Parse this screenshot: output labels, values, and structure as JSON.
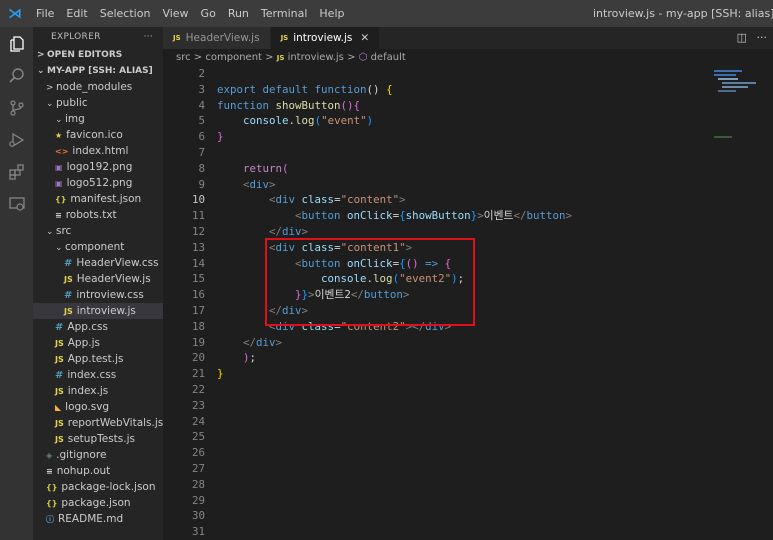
{
  "titlebar": {
    "menu": [
      "File",
      "Edit",
      "Selection",
      "View",
      "Go",
      "Run",
      "Terminal",
      "Help"
    ],
    "window_title": "introview.js - my-app [SSH: alias] - Visual Studio"
  },
  "activity_bar": [
    "files-icon",
    "search-icon",
    "source-control-icon",
    "run-debug-icon",
    "extensions-icon",
    "remote-explorer-icon"
  ],
  "sidebar": {
    "header": "EXPLORER",
    "header_more": "···",
    "open_editors": "OPEN EDITORS",
    "project": "MY-APP [SSH: ALIAS]",
    "items": [
      {
        "label": "node_modules",
        "chev": ">",
        "indent": 1,
        "icon": ""
      },
      {
        "label": "public",
        "chev": "⌄",
        "indent": 1,
        "icon": ""
      },
      {
        "label": "img",
        "chev": "⌄",
        "indent": 2,
        "icon": ""
      },
      {
        "label": "favicon.ico",
        "chev": "",
        "indent": 2,
        "icon": "★",
        "icls": "ic-star"
      },
      {
        "label": "index.html",
        "chev": "",
        "indent": 2,
        "icon": "<>",
        "icls": "ic-html"
      },
      {
        "label": "logo192.png",
        "chev": "",
        "indent": 2,
        "icon": "▣",
        "icls": "ic-img"
      },
      {
        "label": "logo512.png",
        "chev": "",
        "indent": 2,
        "icon": "▣",
        "icls": "ic-img"
      },
      {
        "label": "manifest.json",
        "chev": "",
        "indent": 2,
        "icon": "{}",
        "icls": "ic-json"
      },
      {
        "label": "robots.txt",
        "chev": "",
        "indent": 2,
        "icon": "≡",
        "icls": "ic-txt"
      },
      {
        "label": "src",
        "chev": "⌄",
        "indent": 1,
        "icon": ""
      },
      {
        "label": "component",
        "chev": "⌄",
        "indent": 2,
        "icon": ""
      },
      {
        "label": "HeaderView.css",
        "chev": "",
        "indent": 3,
        "icon": "#",
        "icls": "ic-css"
      },
      {
        "label": "HeaderView.js",
        "chev": "",
        "indent": 3,
        "icon": "JS",
        "icls": "ic-js"
      },
      {
        "label": "introview.css",
        "chev": "",
        "indent": 3,
        "icon": "#",
        "icls": "ic-css"
      },
      {
        "label": "introview.js",
        "chev": "",
        "indent": 3,
        "icon": "JS",
        "icls": "ic-js",
        "selected": true
      },
      {
        "label": "App.css",
        "chev": "",
        "indent": 2,
        "icon": "#",
        "icls": "ic-css"
      },
      {
        "label": "App.js",
        "chev": "",
        "indent": 2,
        "icon": "JS",
        "icls": "ic-js"
      },
      {
        "label": "App.test.js",
        "chev": "",
        "indent": 2,
        "icon": "JS",
        "icls": "ic-js"
      },
      {
        "label": "index.css",
        "chev": "",
        "indent": 2,
        "icon": "#",
        "icls": "ic-css"
      },
      {
        "label": "index.js",
        "chev": "",
        "indent": 2,
        "icon": "JS",
        "icls": "ic-js"
      },
      {
        "label": "logo.svg",
        "chev": "",
        "indent": 2,
        "icon": "◣",
        "icls": "ic-svg"
      },
      {
        "label": "reportWebVitals.js",
        "chev": "",
        "indent": 2,
        "icon": "JS",
        "icls": "ic-js"
      },
      {
        "label": "setupTests.js",
        "chev": "",
        "indent": 2,
        "icon": "JS",
        "icls": "ic-js"
      },
      {
        "label": ".gitignore",
        "chev": "",
        "indent": 1,
        "icon": "◈",
        "icls": "ic-git"
      },
      {
        "label": "nohup.out",
        "chev": "",
        "indent": 1,
        "icon": "≡",
        "icls": "ic-txt"
      },
      {
        "label": "package-lock.json",
        "chev": "",
        "indent": 1,
        "icon": "{}",
        "icls": "ic-json"
      },
      {
        "label": "package.json",
        "chev": "",
        "indent": 1,
        "icon": "{}",
        "icls": "ic-json"
      },
      {
        "label": "README.md",
        "chev": "",
        "indent": 1,
        "icon": "ⓘ",
        "icls": "ic-info"
      }
    ]
  },
  "tabs": [
    {
      "label": "HeaderView.js",
      "active": false
    },
    {
      "label": "introview.js",
      "active": true,
      "close": "✕"
    }
  ],
  "tab_actions": {
    "split": "◫",
    "more": "···"
  },
  "breadcrumb": {
    "parts": [
      "src",
      "component",
      "introview.js",
      "default"
    ],
    "sep": ">"
  },
  "editor": {
    "current_line": 10,
    "lines": [
      {
        "n": 2,
        "tokens": []
      },
      {
        "n": 3,
        "tokens": [
          [
            "kw",
            "export "
          ],
          [
            "kw",
            "default "
          ],
          [
            "kw",
            "function"
          ],
          [
            "txt",
            "() "
          ],
          [
            "brace2",
            "{"
          ]
        ]
      },
      {
        "n": 4,
        "tokens": [
          [
            "kw",
            "function "
          ],
          [
            "fn",
            "showButton"
          ],
          [
            "brace",
            "()"
          ],
          [
            "brace",
            "{"
          ]
        ]
      },
      {
        "n": 5,
        "tokens": [
          [
            "txt",
            "    "
          ],
          [
            "var",
            "console"
          ],
          [
            "txt",
            "."
          ],
          [
            "fn",
            "log"
          ],
          [
            "brace3",
            "("
          ],
          [
            "str",
            "\"event\""
          ],
          [
            "brace3",
            ")"
          ]
        ]
      },
      {
        "n": 6,
        "tokens": [
          [
            "brace",
            "}"
          ]
        ]
      },
      {
        "n": 7,
        "tokens": []
      },
      {
        "n": 8,
        "tokens": [
          [
            "txt",
            "    "
          ],
          [
            "kw2",
            "return"
          ],
          [
            "brace",
            "("
          ]
        ]
      },
      {
        "n": 9,
        "tokens": [
          [
            "txt",
            "    "
          ],
          [
            "punc",
            "<"
          ],
          [
            "tag",
            "div"
          ],
          [
            "punc",
            ">"
          ]
        ]
      },
      {
        "n": 10,
        "tokens": [
          [
            "txt",
            "        "
          ],
          [
            "punc",
            "<"
          ],
          [
            "tag",
            "div "
          ],
          [
            "attr",
            "class"
          ],
          [
            "txt",
            "="
          ],
          [
            "str",
            "\"content\""
          ],
          [
            "punc",
            ">"
          ]
        ]
      },
      {
        "n": 11,
        "tokens": [
          [
            "txt",
            "            "
          ],
          [
            "punc",
            "<"
          ],
          [
            "tag",
            "button "
          ],
          [
            "attr",
            "onClick"
          ],
          [
            "txt",
            "="
          ],
          [
            "brace3",
            "{"
          ],
          [
            "var",
            "showButton"
          ],
          [
            "brace3",
            "}"
          ],
          [
            "punc",
            ">"
          ],
          [
            "txt",
            "이벤트"
          ],
          [
            "punc",
            "</"
          ],
          [
            "tag",
            "button"
          ],
          [
            "punc",
            ">"
          ]
        ]
      },
      {
        "n": 12,
        "tokens": [
          [
            "txt",
            "        "
          ],
          [
            "punc",
            "</"
          ],
          [
            "tag",
            "div"
          ],
          [
            "punc",
            ">"
          ]
        ]
      },
      {
        "n": 13,
        "tokens": [
          [
            "txt",
            "        "
          ],
          [
            "punc",
            "<"
          ],
          [
            "tag",
            "div "
          ],
          [
            "attr",
            "class"
          ],
          [
            "txt",
            "="
          ],
          [
            "str",
            "\"content1\""
          ],
          [
            "punc",
            ">"
          ]
        ]
      },
      {
        "n": 14,
        "tokens": [
          [
            "txt",
            "            "
          ],
          [
            "punc",
            "<"
          ],
          [
            "tag",
            "button "
          ],
          [
            "attr",
            "onClick"
          ],
          [
            "txt",
            "="
          ],
          [
            "brace3",
            "{"
          ],
          [
            "brace",
            "() "
          ],
          [
            "kw",
            "=>"
          ],
          [
            "txt",
            " "
          ],
          [
            "brace",
            "{"
          ]
        ]
      },
      {
        "n": 15,
        "tokens": [
          [
            "txt",
            "                "
          ],
          [
            "var",
            "console"
          ],
          [
            "txt",
            "."
          ],
          [
            "fn",
            "log"
          ],
          [
            "brace3",
            "("
          ],
          [
            "str",
            "\"event2\""
          ],
          [
            "brace3",
            ")"
          ],
          [
            "txt",
            ";"
          ]
        ]
      },
      {
        "n": 16,
        "tokens": [
          [
            "txt",
            "            "
          ],
          [
            "brace",
            "}"
          ],
          [
            "brace3",
            "}"
          ],
          [
            "punc",
            ">"
          ],
          [
            "txt",
            "이벤트2"
          ],
          [
            "punc",
            "</"
          ],
          [
            "tag",
            "button"
          ],
          [
            "punc",
            ">"
          ]
        ]
      },
      {
        "n": 17,
        "tokens": [
          [
            "txt",
            "        "
          ],
          [
            "punc",
            "</"
          ],
          [
            "tag",
            "div"
          ],
          [
            "punc",
            ">"
          ]
        ]
      },
      {
        "n": 18,
        "tokens": [
          [
            "txt",
            "        "
          ],
          [
            "punc",
            "<"
          ],
          [
            "tag",
            "div "
          ],
          [
            "attr",
            "class"
          ],
          [
            "txt",
            "="
          ],
          [
            "str",
            "\"content2\""
          ],
          [
            "punc",
            "></"
          ],
          [
            "tag",
            "div"
          ],
          [
            "punc",
            ">"
          ]
        ]
      },
      {
        "n": 19,
        "tokens": [
          [
            "txt",
            "    "
          ],
          [
            "punc",
            "</"
          ],
          [
            "tag",
            "div"
          ],
          [
            "punc",
            ">"
          ]
        ]
      },
      {
        "n": 20,
        "tokens": [
          [
            "txt",
            "    "
          ],
          [
            "brace",
            ")"
          ],
          [
            "txt",
            ";"
          ]
        ]
      },
      {
        "n": 21,
        "tokens": [
          [
            "brace2",
            "}"
          ]
        ]
      },
      {
        "n": 22,
        "tokens": []
      },
      {
        "n": 23,
        "tokens": []
      },
      {
        "n": 24,
        "tokens": []
      },
      {
        "n": 25,
        "tokens": []
      },
      {
        "n": 26,
        "tokens": []
      },
      {
        "n": 27,
        "tokens": []
      },
      {
        "n": 28,
        "tokens": []
      },
      {
        "n": 29,
        "tokens": []
      },
      {
        "n": 30,
        "tokens": []
      },
      {
        "n": 31,
        "tokens": []
      }
    ]
  }
}
